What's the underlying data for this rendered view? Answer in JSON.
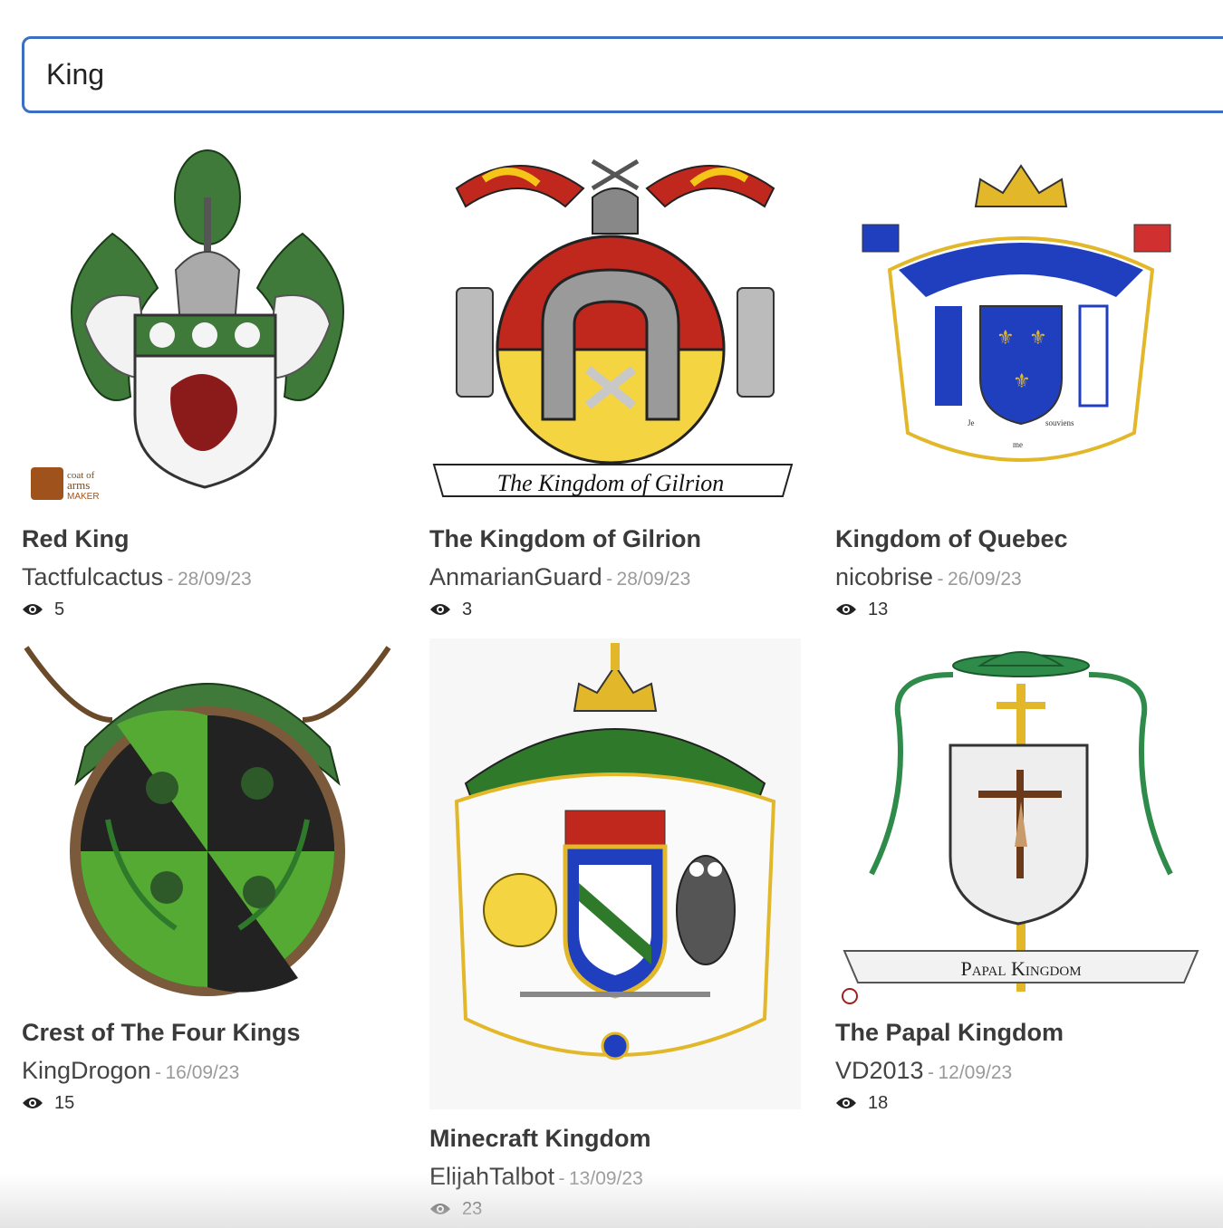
{
  "search": {
    "value": "King"
  },
  "cards": [
    {
      "title": "Red King",
      "author": "Tactfulcactus",
      "date": "28/09/23",
      "views": "5",
      "icon": "coat-of-arms-image"
    },
    {
      "title": "The Kingdom of Gilrion",
      "author": "AnmarianGuard",
      "date": "28/09/23",
      "views": "3",
      "icon": "coat-of-arms-image",
      "banner": "The Kingdom of Gilrion"
    },
    {
      "title": "Kingdom of Quebec",
      "author": "nicobrise",
      "date": "26/09/23",
      "views": "13",
      "icon": "coat-of-arms-image",
      "motto": [
        "Je",
        "me",
        "souviens"
      ]
    },
    {
      "title": "Crest of The Four Kings",
      "author": "KingDrogon",
      "date": "16/09/23",
      "views": "15",
      "icon": "coat-of-arms-image"
    },
    {
      "title": "Minecraft Kingdom",
      "author": "ElijahTalbot",
      "date": "13/09/23",
      "views": "23",
      "icon": "coat-of-arms-image"
    },
    {
      "title": "The Papal Kingdom",
      "author": "VD2013",
      "date": "12/09/23",
      "views": "18",
      "icon": "coat-of-arms-image",
      "banner": "Papal Kingdom"
    }
  ],
  "watermark": [
    "coat of",
    "arms",
    "MAKER"
  ],
  "separator": "-",
  "colors": {
    "search_border": "#3a6fc4",
    "title": "#3a3a3a",
    "date": "#9a9a9a"
  }
}
